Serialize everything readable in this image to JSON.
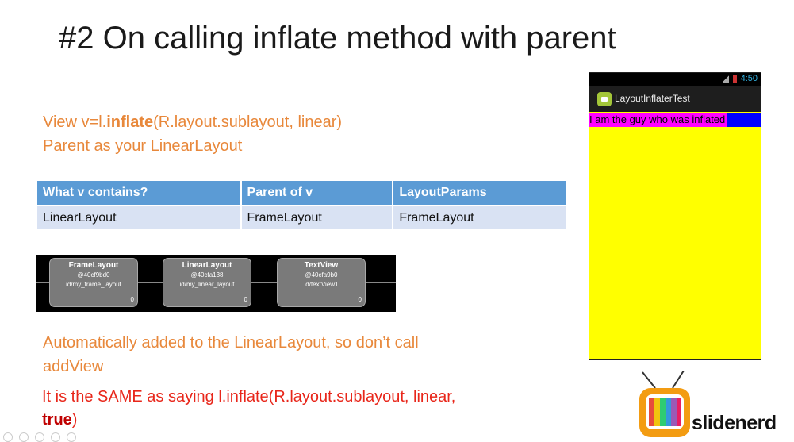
{
  "slide": {
    "title": "#2 On calling inflate method with parent",
    "code_prefix": "View v=l.",
    "code_bold": "inflate",
    "code_suffix": "(R.layout.sublayout, linear)",
    "parent_line": "Parent as your LinearLayout",
    "auto_line1": "Automatically added to the LinearLayout, so don’t call",
    "auto_line2": "addView",
    "same_line1": "It is the SAME as saying l.inflate(R.layout.sublayout, linear,",
    "same_bold": "true",
    "same_end": ")"
  },
  "table": {
    "headers": [
      "What v contains?",
      "Parent of v",
      "LayoutParams"
    ],
    "row": [
      "LinearLayout",
      "FrameLayout",
      "FrameLayout"
    ]
  },
  "hierarchy": {
    "nodes": [
      {
        "name": "FrameLayout",
        "addr": "@40cf9bd0",
        "id": "id/my_frame_layout",
        "count": "0"
      },
      {
        "name": "LinearLayout",
        "addr": "@40cfa138",
        "id": "id/my_linear_layout",
        "count": "0"
      },
      {
        "name": "TextView",
        "addr": "@40cfa9b0",
        "id": "id/textView1",
        "count": "0"
      }
    ]
  },
  "phone": {
    "time": "4:50",
    "app_title": "LayoutInflaterTest",
    "inflated_text": "I am the guy who was inflated",
    "bg_color": "#ffff00"
  },
  "brand": {
    "name": "slidenerd"
  },
  "colors": {
    "orange": "#e8883b",
    "red": "#e8261a",
    "table_header": "#5b9bd5",
    "table_row": "#d9e2f3"
  }
}
